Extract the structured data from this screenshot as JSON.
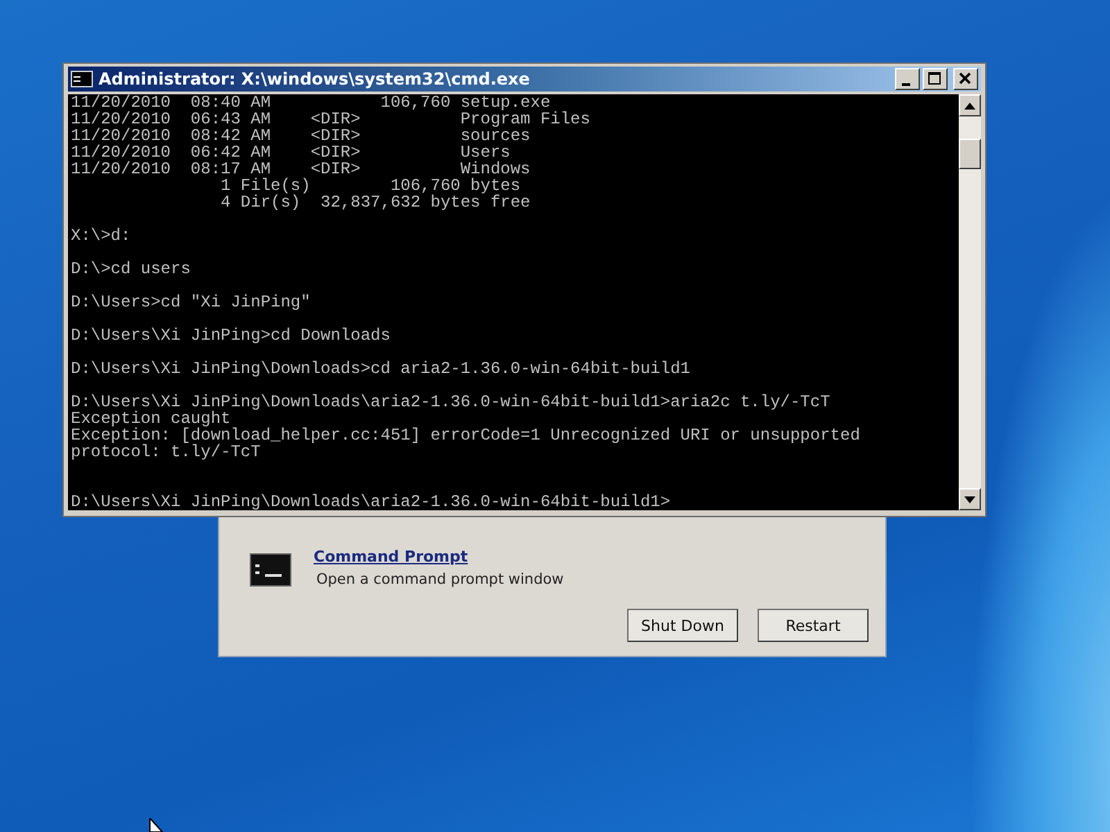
{
  "console_window": {
    "title": "Administrator: X:\\windows\\system32\\cmd.exe",
    "output_blocks": [
      {
        "lines": [
          "11/20/2010  08:40 AM           106,760 setup.exe",
          "11/20/2010  06:43 AM    <DIR>          Program Files",
          "11/20/2010  08:42 AM    <DIR>          sources",
          "11/20/2010  06:42 AM    <DIR>          Users",
          "11/20/2010  08:17 AM    <DIR>          Windows",
          "               1 File(s)        106,760 bytes",
          "               4 Dir(s)  32,837,632 bytes free"
        ]
      },
      {
        "lines": [
          "X:\\>d:"
        ]
      },
      {
        "lines": [
          "D:\\>cd users"
        ]
      },
      {
        "lines": [
          "D:\\Users>cd \"Xi JinPing\""
        ]
      },
      {
        "lines": [
          "D:\\Users\\Xi JinPing>cd Downloads"
        ]
      },
      {
        "lines": [
          "D:\\Users\\Xi JinPing\\Downloads>cd aria2-1.36.0-win-64bit-build1"
        ]
      },
      {
        "lines": [
          "D:\\Users\\Xi JinPing\\Downloads\\aria2-1.36.0-win-64bit-build1>aria2c t.ly/-TcT",
          "Exception caught",
          "Exception: [download_helper.cc:451] errorCode=1 Unrecognized URI or unsupported",
          "protocol: t.ly/-TcT"
        ]
      },
      {
        "lines": [
          "D:\\Users\\Xi JinPing\\Downloads\\aria2-1.36.0-win-64bit-build1>"
        ]
      }
    ]
  },
  "recovery_dialog": {
    "tools": [
      {
        "name": "Command Prompt",
        "description": "Open a command prompt window"
      }
    ],
    "buttons": [
      "Shut Down",
      "Restart"
    ]
  }
}
